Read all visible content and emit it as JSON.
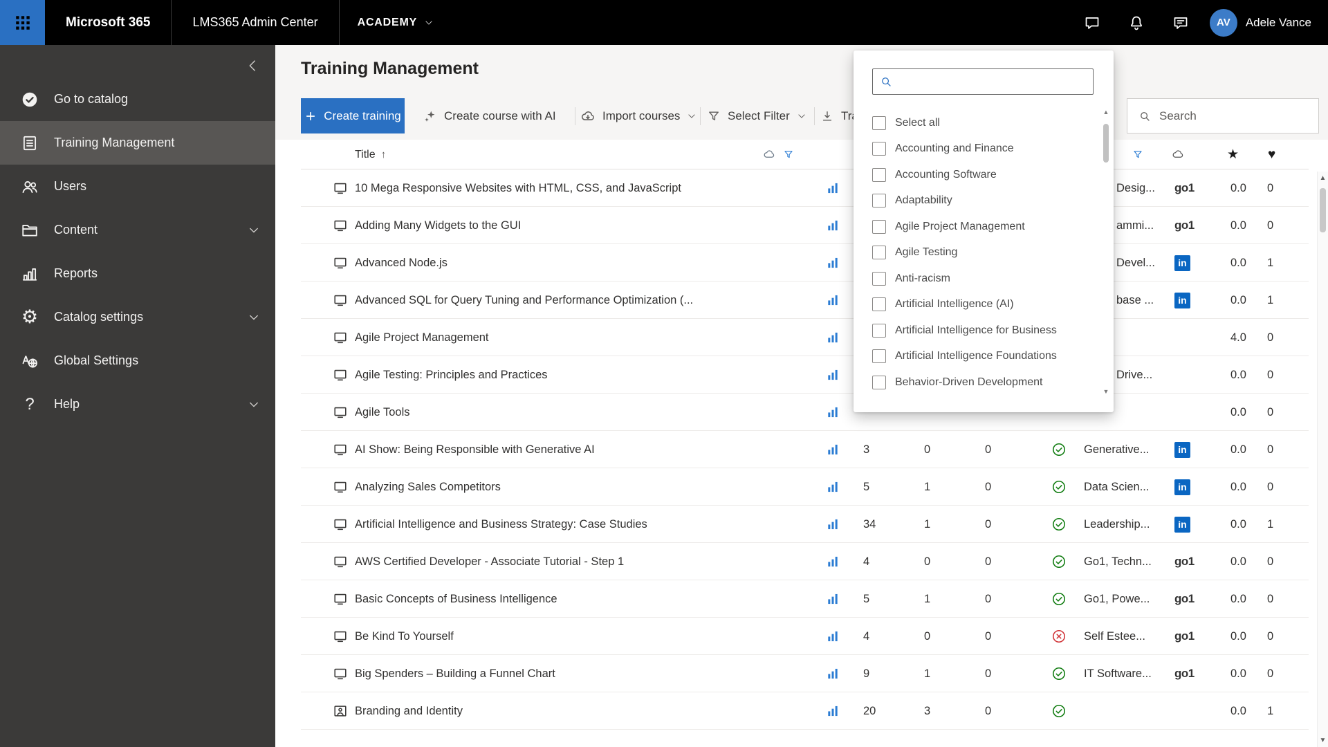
{
  "colors": {
    "accent": "#2a70c2",
    "linkedin": "#0a66c2",
    "success": "#107c10",
    "error": "#d13438"
  },
  "topbar": {
    "brand": "Microsoft 365",
    "admin_center": "LMS365 Admin Center",
    "academy": "ACADEMY",
    "user_initials": "AV",
    "user_name": "Adele Vance"
  },
  "sidebar": {
    "items": [
      {
        "label": "Go to catalog",
        "icon": "catalog",
        "chevron": false,
        "active": false
      },
      {
        "label": "Training Management",
        "icon": "training",
        "chevron": false,
        "active": true
      },
      {
        "label": "Users",
        "icon": "users",
        "chevron": false,
        "active": false
      },
      {
        "label": "Content",
        "icon": "folder",
        "chevron": true,
        "active": false
      },
      {
        "label": "Reports",
        "icon": "reports",
        "chevron": false,
        "active": false
      },
      {
        "label": "Catalog settings",
        "icon": "gear",
        "chevron": true,
        "active": false
      },
      {
        "label": "Global Settings",
        "icon": "globalsettings",
        "chevron": false,
        "active": false
      },
      {
        "label": "Help",
        "icon": "help",
        "chevron": true,
        "active": false
      }
    ]
  },
  "page": {
    "title": "Training Management"
  },
  "toolbar": {
    "create_training": "Create training",
    "create_course_ai": "Create course with AI",
    "import_courses": "Import courses",
    "select_filter": "Select Filter",
    "training_sync_partial": "Tra",
    "search_placeholder": "Search"
  },
  "providers": {
    "go1": "go1",
    "linkedin": "in"
  },
  "table": {
    "header": {
      "title": "Title"
    },
    "rows": [
      {
        "icon": "monitor",
        "title": "10 Mega Responsive Websites with HTML, CSS, and JavaScript",
        "enrolled": "",
        "completed": "",
        "in_progress": "",
        "status": null,
        "category": "Desig...",
        "category_clipped": true,
        "provider": "go1",
        "rating": "0.0",
        "likes": "0"
      },
      {
        "icon": "monitor",
        "title": "Adding Many Widgets to the GUI",
        "enrolled": "",
        "completed": "",
        "in_progress": "",
        "status": null,
        "category": "ammi...",
        "category_clipped": true,
        "provider": "go1",
        "rating": "0.0",
        "likes": "0"
      },
      {
        "icon": "monitor",
        "title": "Advanced Node.js",
        "enrolled": "",
        "completed": "",
        "in_progress": "",
        "status": null,
        "category": "Devel...",
        "category_clipped": true,
        "provider": "linkedin",
        "rating": "0.0",
        "likes": "1"
      },
      {
        "icon": "monitor",
        "title": "Advanced SQL for Query Tuning and Performance Optimization (...",
        "enrolled": "",
        "completed": "",
        "in_progress": "",
        "status": null,
        "category": "base ...",
        "category_clipped": true,
        "provider": "linkedin",
        "rating": "0.0",
        "likes": "1"
      },
      {
        "icon": "monitor",
        "title": "Agile Project Management",
        "enrolled": "",
        "completed": "",
        "in_progress": "",
        "status": null,
        "category": "",
        "category_clipped": false,
        "provider": null,
        "rating": "4.0",
        "likes": "0"
      },
      {
        "icon": "monitor",
        "title": "Agile Testing: Principles and Practices",
        "enrolled": "",
        "completed": "",
        "in_progress": "",
        "status": null,
        "category": "Drive...",
        "category_clipped": true,
        "provider": null,
        "rating": "0.0",
        "likes": "0"
      },
      {
        "icon": "monitor",
        "title": "Agile Tools",
        "enrolled": "",
        "completed": "",
        "in_progress": "",
        "status": null,
        "category": "",
        "category_clipped": false,
        "provider": null,
        "rating": "0.0",
        "likes": "0"
      },
      {
        "icon": "monitor",
        "title": "AI Show: Being Responsible with Generative AI",
        "enrolled": "3",
        "completed": "0",
        "in_progress": "0",
        "status": "check",
        "category": "Generative...",
        "category_clipped": false,
        "provider": "linkedin",
        "rating": "0.0",
        "likes": "0"
      },
      {
        "icon": "monitor",
        "title": "Analyzing Sales Competitors",
        "enrolled": "5",
        "completed": "1",
        "in_progress": "0",
        "status": "check",
        "category": "Data Scien...",
        "category_clipped": false,
        "provider": "linkedin",
        "rating": "0.0",
        "likes": "0"
      },
      {
        "icon": "monitor",
        "title": "Artificial Intelligence and Business Strategy: Case Studies",
        "enrolled": "34",
        "completed": "1",
        "in_progress": "0",
        "status": "check",
        "category": "Leadership...",
        "category_clipped": false,
        "provider": "linkedin",
        "rating": "0.0",
        "likes": "1"
      },
      {
        "icon": "monitor",
        "title": "AWS Certified Developer - Associate Tutorial - Step 1",
        "enrolled": "4",
        "completed": "0",
        "in_progress": "0",
        "status": "check",
        "category": "Go1, Techn...",
        "category_clipped": false,
        "provider": "go1",
        "rating": "0.0",
        "likes": "0"
      },
      {
        "icon": "monitor",
        "title": "Basic Concepts of Business Intelligence",
        "enrolled": "5",
        "completed": "1",
        "in_progress": "0",
        "status": "check",
        "category": "Go1, Powe...",
        "category_clipped": false,
        "provider": "go1",
        "rating": "0.0",
        "likes": "0"
      },
      {
        "icon": "monitor",
        "title": "Be Kind To Yourself",
        "enrolled": "4",
        "completed": "0",
        "in_progress": "0",
        "status": "cross",
        "category": "Self Estee...",
        "category_clipped": false,
        "provider": "go1",
        "rating": "0.0",
        "likes": "0"
      },
      {
        "icon": "monitor",
        "title": "Big Spenders – Building a Funnel Chart",
        "enrolled": "9",
        "completed": "1",
        "in_progress": "0",
        "status": "check",
        "category": "IT Software...",
        "category_clipped": false,
        "provider": "go1",
        "rating": "0.0",
        "likes": "0"
      },
      {
        "icon": "image",
        "title": "Branding and Identity",
        "enrolled": "20",
        "completed": "3",
        "in_progress": "0",
        "status": "check",
        "category": "",
        "category_clipped": false,
        "provider": null,
        "rating": "0.0",
        "likes": "1"
      }
    ]
  },
  "filter_panel": {
    "options": [
      "Select all",
      "Accounting and Finance",
      "Accounting Software",
      "Adaptability",
      "Agile Project Management",
      "Agile Testing",
      "Anti-racism",
      "Artificial Intelligence (AI)",
      "Artificial Intelligence for Business",
      "Artificial Intelligence Foundations",
      "Behavior-Driven Development"
    ]
  }
}
